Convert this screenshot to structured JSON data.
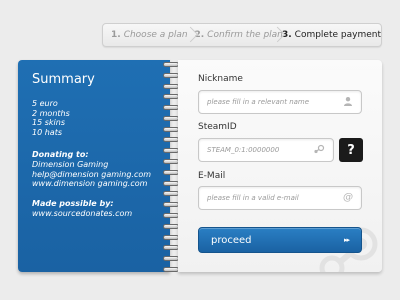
{
  "steps": [
    {
      "num": "1.",
      "label": "Choose a plan"
    },
    {
      "num": "2.",
      "label": "Confirm the plan"
    },
    {
      "num": "3.",
      "label": "Complete payment"
    }
  ],
  "summary": {
    "title": "Summary",
    "items": [
      "5 euro",
      "2 months",
      "15 skins",
      "10 hats"
    ],
    "donating_heading": "Donating to:",
    "donating_lines": [
      "Dimension Gaming",
      "help@dimension gaming.com",
      "www.dimension gaming.com"
    ],
    "made_heading": "Made possible by:",
    "made_lines": [
      "www.sourcedonates.com"
    ]
  },
  "form": {
    "nickname_label": "Nickname",
    "nickname_placeholder": "please fill in a relevant name",
    "steamid_label": "SteamID",
    "steamid_placeholder": "STEAM_0:1:0000000",
    "help_label": "?",
    "email_label": "E-Mail",
    "email_placeholder": "please fill in a valid e-mail",
    "proceed_label": "proceed",
    "proceed_arrows": "▸▸"
  },
  "icons": {
    "nickname": "user-icon",
    "steamid": "steam-icon",
    "email": "at-sign-icon",
    "proceed": "double-chevron-icon",
    "watermark": "steam-logo-icon"
  },
  "colors": {
    "accent": "#1a62a3",
    "button_top": "#2a7fc4",
    "help_button": "#1b1b1b",
    "background": "#ececec"
  }
}
